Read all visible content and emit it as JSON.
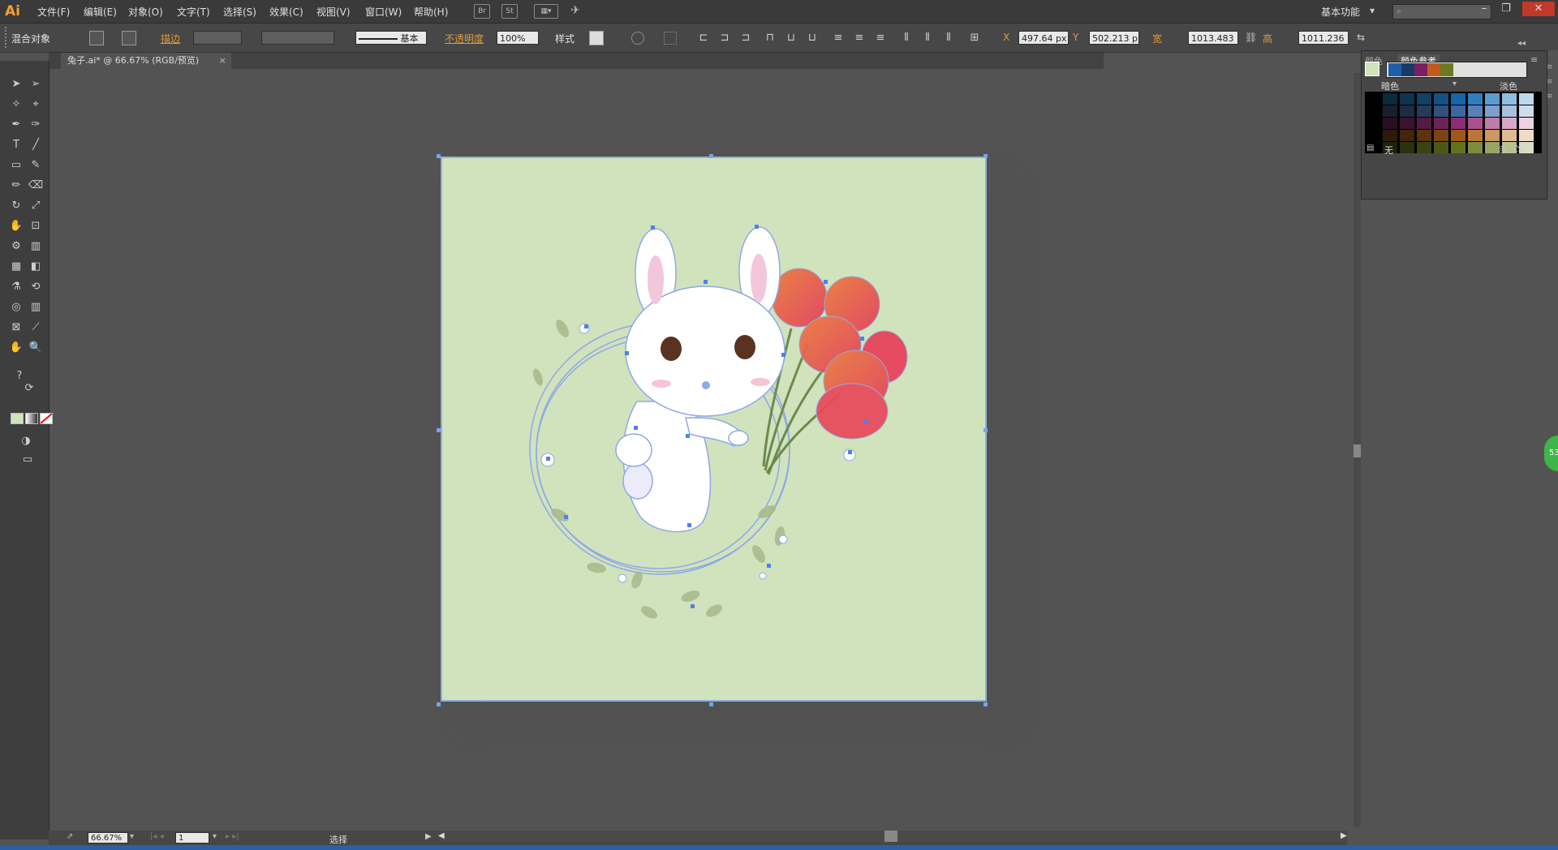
{
  "app": {
    "logo": "Ai"
  },
  "menu": [
    "文件(F)",
    "编辑(E)",
    "对象(O)",
    "文字(T)",
    "选择(S)",
    "效果(C)",
    "视图(V)",
    "窗口(W)",
    "帮助(H)"
  ],
  "menu_icons": [
    "Br",
    "St"
  ],
  "workspace": "基本功能",
  "control": {
    "object_type": "混合对象",
    "stroke_label": "描边",
    "stroke_style": "基本",
    "opacity_label": "不透明度",
    "opacity_value": "100%",
    "style_label": "样式",
    "x_label": "X",
    "x_value": "497.64 px",
    "y_label": "Y",
    "y_value": "502.213 p",
    "w_label": "宽",
    "w_value": "1013.483",
    "h_label": "高",
    "h_value": "1011.236"
  },
  "document_tab": "兔子.ai* @ 66.67% (RGB/预览)",
  "color_guide": {
    "tab_color": "颜色",
    "tab_guide": "颜色参考",
    "dark_label": "暗色",
    "light_label": "淡色",
    "none_label": "无",
    "harmony": [
      "#1f5fa8",
      "#183b66",
      "#7a1f63",
      "#c25a1e",
      "#6b7a1f"
    ],
    "rows": [
      [
        "#0b2a3a",
        "#0e3550",
        "#114266",
        "#135185",
        "#1566aa",
        "#2d7fc0",
        "#5a9cd0",
        "#8dbde0",
        "#bcd9ee"
      ],
      [
        "#1a1f30",
        "#202a42",
        "#283a5a",
        "#31507c",
        "#3f66a0",
        "#5a80b8",
        "#7f9ecc",
        "#a9bfdd",
        "#d0dcec"
      ],
      [
        "#2a0f22",
        "#3d1330",
        "#541a42",
        "#6f2257",
        "#8e2e72",
        "#a9528e",
        "#c07ca8",
        "#d7a7c6",
        "#ecd2e3"
      ],
      [
        "#2f1a0a",
        "#44240c",
        "#5d320f",
        "#7b4313",
        "#a0581a",
        "#bb7638",
        "#cd9763",
        "#dfba92",
        "#efdcc6"
      ],
      [
        "#1e220a",
        "#2b310d",
        "#3a4311",
        "#4c5916",
        "#63731d",
        "#7c8c3a",
        "#97a463",
        "#b7c192",
        "#d8dec3"
      ]
    ]
  },
  "status": {
    "zoom": "66.67%",
    "artboard": "1",
    "tool_name": "选择"
  },
  "badge": "53"
}
